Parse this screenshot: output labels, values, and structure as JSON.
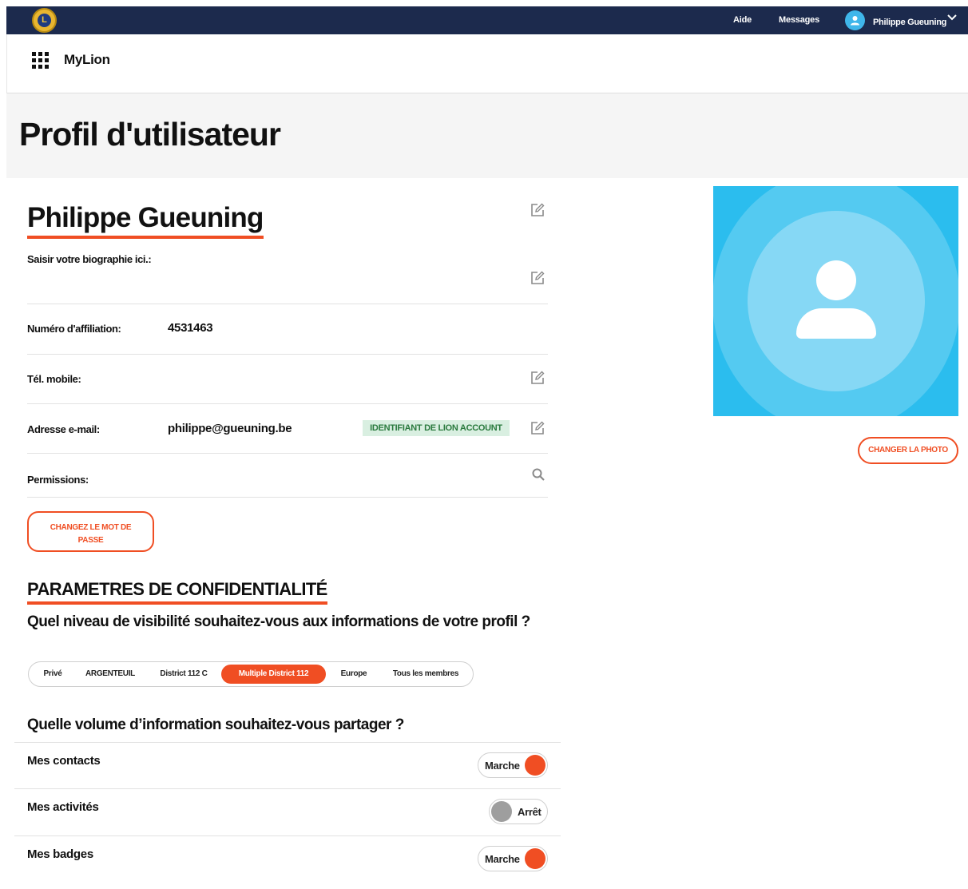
{
  "topbar": {
    "logo_letter": "L",
    "help": "Aide",
    "messages": "Messages",
    "user_name": "Philippe Gueuning"
  },
  "appbar": {
    "title": "MyLion"
  },
  "page": {
    "title": "Profil d'utilisateur"
  },
  "profile": {
    "name": "Philippe Gueuning",
    "bio_label": "Saisir votre biographie ici.:",
    "membership_label": "Numéro d'affiliation:",
    "membership_value": "4531463",
    "mobile_label": "Tél. mobile:",
    "email_label": "Adresse e-mail:",
    "email_value": "philippe@gueuning.be",
    "email_badge": "IDENTIFIANT DE LION ACCOUNT",
    "permissions_label": "Permissions:",
    "change_password": "CHANGEZ LE MOT DE PASSE",
    "change_photo": "CHANGER LA PHOTO"
  },
  "privacy": {
    "title": "PARAMETRES DE CONFIDENTIALITÉ",
    "visibility_question": "Quel niveau de visibilité souhaitez-vous aux informations de votre profil ?",
    "visibility_options": [
      "Privé",
      "ARGENTEUIL",
      "District 112 C",
      "Multiple District 112",
      "Europe",
      "Tous les membres"
    ],
    "visibility_selected": "Multiple District 112",
    "volume_question": "Quelle volume d’information souhaitez-vous partager ?",
    "rows": [
      {
        "label": "Mes contacts",
        "state": "Marche",
        "on": true
      },
      {
        "label": "Mes activités",
        "state": "Arrêt",
        "on": false
      },
      {
        "label": "Mes badges",
        "state": "Marche",
        "on": true
      }
    ]
  },
  "colors": {
    "accent": "#f04e23",
    "topbar": "#1c2a4d",
    "toggle_off": "#9e9e9e",
    "badge_bg": "#d9efe1",
    "badge_text": "#2a7a3e",
    "photo_bg": "#2bbdee"
  },
  "icons": [
    "lions-logo",
    "avatar-icon",
    "chevron-down-icon",
    "grid-icon",
    "edit-icon",
    "search-icon"
  ]
}
